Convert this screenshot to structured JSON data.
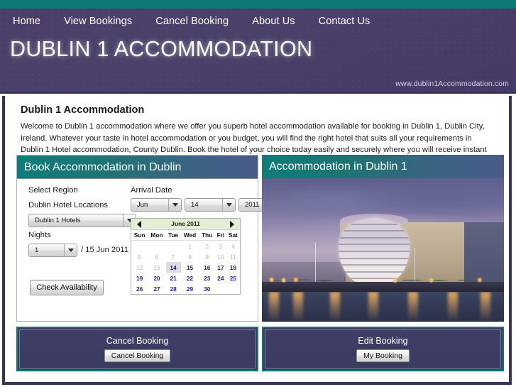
{
  "site": {
    "url_label": "www.dublin1Accommodation.com",
    "logo_text": "DUBLIN 1 ACCOMMODATION",
    "accent_teal": "#0b7a76",
    "banner_purple": "#4a406a",
    "border_navy": "#3b3358"
  },
  "nav": {
    "items": [
      {
        "label": "Home"
      },
      {
        "label": "View Bookings"
      },
      {
        "label": "Cancel Booking"
      },
      {
        "label": "About Us"
      },
      {
        "label": "Contact Us"
      }
    ]
  },
  "main": {
    "page_title": "Dublin 1 Accommodation",
    "intro": "Welcome to Dublin 1 accommodation where we offer you superb hotel accommodation available for booking in Dublin 1, Dublin City, Ireland. Whatever your taste in hotel accommodation or you budget, you will find the right hotel that suits all your requirements in Dublin 1 Hotel accommodation, County Dublin. Book the hotel of your choice today easily and securely where you will receive instant confirmation."
  },
  "booking_panel": {
    "title": "Book Accommodation in Dublin",
    "select_region_label": "Select Region",
    "locations_label": "Dublin Hotel Locations",
    "locations_value": "Dublin 1  Hotels",
    "nights_label": "Nights",
    "nights_value": "1",
    "departure_text": "/ 15 Jun 2011",
    "arrival_label": "Arrival Date",
    "arrival_month": "Jun",
    "arrival_day": "14",
    "arrival_year": "2011",
    "check_button": "Check Availability"
  },
  "calendar": {
    "title": "June 2011",
    "prev_label": "◀",
    "next_label": "▶",
    "weekdays": [
      "Sun",
      "Mon",
      "Tue",
      "Wed",
      "Thu",
      "Fri",
      "Sat"
    ],
    "selected_day": 14,
    "disabled_through": 13,
    "weeks": [
      [
        null,
        null,
        null,
        1,
        2,
        3,
        4
      ],
      [
        5,
        6,
        7,
        8,
        9,
        10,
        11
      ],
      [
        12,
        13,
        14,
        15,
        16,
        17,
        18
      ],
      [
        19,
        20,
        21,
        22,
        23,
        24,
        25
      ],
      [
        26,
        27,
        28,
        29,
        30,
        null,
        null
      ]
    ]
  },
  "photo_panel": {
    "title": "Accommodation in Dublin 1",
    "image_alt": "dublin-convention-centre-at-dusk-photo"
  },
  "bottom": {
    "cancel": {
      "title": "Cancel Booking",
      "button": "Cancel Booking"
    },
    "edit": {
      "title": "Edit Booking",
      "button": "My Booking"
    }
  }
}
